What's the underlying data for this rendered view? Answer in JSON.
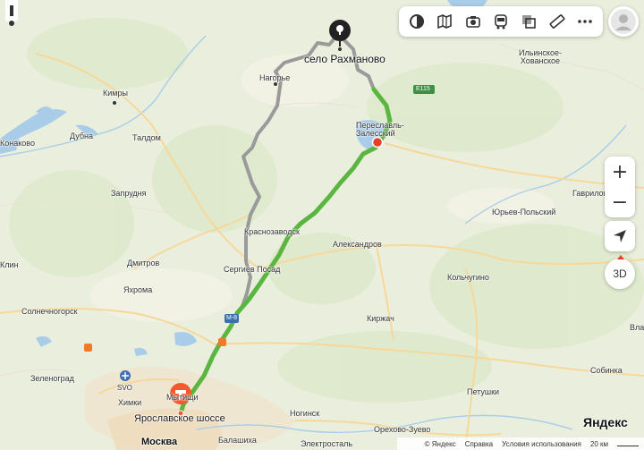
{
  "map": {
    "places": {
      "rakhmanovo": "село Рахманово",
      "nagorye": "Нагорье",
      "ilinskoe": "Ильинское-\nХованское",
      "e115": "E115",
      "kimry": "Кимры",
      "dubna": "Дубна",
      "taldom": "Талдом",
      "konakovo": "Конаково",
      "pereslavl": "Переславль-\nЗалесский",
      "zaprudnya": "Запрудня",
      "gavrilov": "Гаврилов",
      "yuryev": "Юрьев-Польский",
      "krasnozavodsk": "Краснозаводск",
      "aleksandrov": "Александров",
      "klin": "Клин",
      "dmitrov": "Дмитров",
      "sergiev": "Сергиев Посад",
      "kolchugino": "Кольчугино",
      "yakhroma": "Яхрома",
      "solnechnogorsk": "Солнечногорск",
      "m8": "M-8",
      "kirzhach": "Киржач",
      "sobinka": "Собинка",
      "zelenograd": "Зеленоград",
      "svo": "SVO",
      "petushki": "Петушки",
      "khimki": "Химки",
      "mytishchi": "Мытищи",
      "yaroslavskoe": "Ярославское шоссе",
      "noginsk": "Ногинск",
      "orekhovo": "Орехово-Зуево",
      "moskva": "Москва",
      "balashikha": "Балашиха",
      "elektrostal": "Электросталь",
      "vla": "Вла"
    },
    "brand": "Яндекс",
    "footer": {
      "copyright": "© Яндекс",
      "help": "Справка",
      "terms": "Условия использования",
      "scale": "20 км"
    },
    "zoom_in": "+",
    "zoom_out": "−",
    "mode_3d": "3D"
  }
}
